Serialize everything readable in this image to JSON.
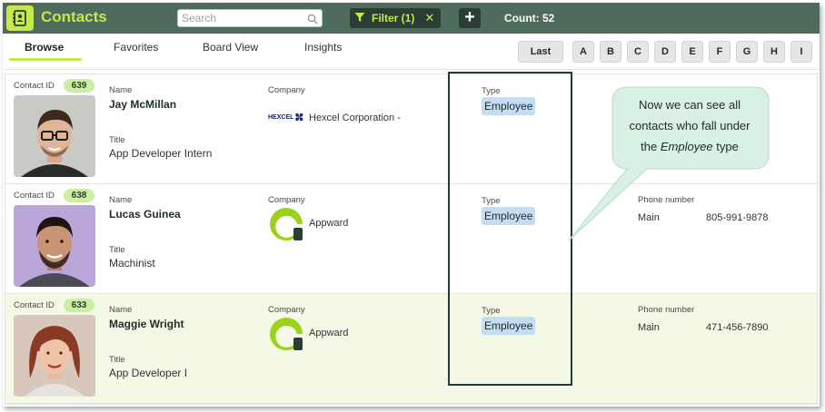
{
  "header": {
    "app_title": "Contacts",
    "app_icon": "address-book-icon",
    "search_placeholder": "Search",
    "filter_label": "Filter (1)",
    "add_label": "+",
    "count_text": "Count: 52"
  },
  "tabs": [
    {
      "label": "Browse",
      "active": true
    },
    {
      "label": "Favorites",
      "active": false
    },
    {
      "label": "Board View",
      "active": false
    },
    {
      "label": "Insights",
      "active": false
    }
  ],
  "alpha": {
    "last_label": "Last",
    "letters": [
      "A",
      "B",
      "C",
      "D",
      "E",
      "F",
      "G",
      "H",
      "I"
    ]
  },
  "labels": {
    "contact_id": "Contact ID",
    "name": "Name",
    "title": "Title",
    "company": "Company",
    "type": "Type",
    "phone": "Phone number"
  },
  "contacts": [
    {
      "id": "639",
      "name": "Jay McMillan",
      "title": "App Developer Intern",
      "company": "Hexcel Corporation -",
      "company_logo_text": "HEXCEL",
      "type": "Employee",
      "phone_type": "",
      "phone": ""
    },
    {
      "id": "638",
      "name": "Lucas Guinea",
      "title": "Machinist",
      "company": "Appward",
      "company_logo_text": "",
      "type": "Employee",
      "phone_type": "Main",
      "phone": "805-991-9878"
    },
    {
      "id": "633",
      "name": "Maggie Wright",
      "title": "App Developer I",
      "company": "Appward",
      "company_logo_text": "",
      "type": "Employee",
      "phone_type": "Main",
      "phone": "471-456-7890"
    }
  ],
  "callout": {
    "line1": "Now we can see all",
    "line2": "contacts who fall under",
    "line3_pre": "the ",
    "line3_em": "Employee",
    "line3_post": " type"
  },
  "colors": {
    "header_bg": "#4e6b5c",
    "accent": "#c5e84a",
    "chip_blue": "#c5ddf3",
    "callout_bg": "#d8f1e4",
    "highlight_row": "#f3f9e4"
  }
}
